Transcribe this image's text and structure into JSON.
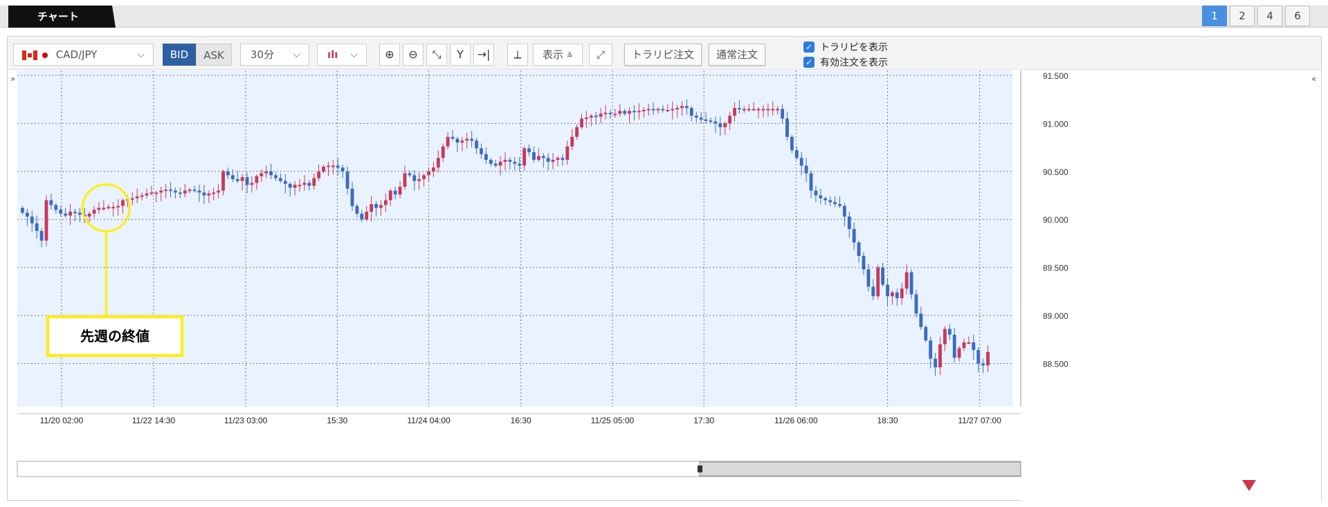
{
  "header": {
    "title": "チャート",
    "layouts": [
      "1",
      "2",
      "4",
      "6"
    ],
    "active_layout": "1"
  },
  "toolbar": {
    "pair": "CAD/JPY",
    "bid_label": "BID",
    "ask_label": "ASK",
    "interval": "30分",
    "show_label": "表示",
    "trail_order_label": "トラリピ注文",
    "normal_order_label": "通常注文",
    "checkbox_trail": "トラリピを表示",
    "checkbox_active_orders": "有効注文を表示",
    "icons": [
      "candlestick-icon",
      "zoom-in-icon",
      "zoom-out-icon",
      "fit-icon",
      "y-lock-icon",
      "jump-latest-icon",
      "add-indicator-icon",
      "expand-icon"
    ]
  },
  "annotation": {
    "label": "先週の終値",
    "color": "#ffee00"
  },
  "chart_data": {
    "type": "candlestick",
    "symbol": "CAD/JPY",
    "ylim": [
      88.05,
      91.55
    ],
    "y_ticks": [
      "91.500",
      "91.000",
      "90.500",
      "90.000",
      "89.500",
      "89.000",
      "88.500"
    ],
    "x_ticks": [
      "11/20 02:00",
      "11/22 14:30",
      "11/23 03:00",
      "15:30",
      "11/24 04:00",
      "16:30",
      "11/25 05:00",
      "17:30",
      "11/26 06:00",
      "18:30",
      "11/27 07:00"
    ],
    "up_color": "#c8385a",
    "down_color": "#3a6bbf",
    "background": "#e9f2ff",
    "grid": true,
    "close_path": [
      90.07,
      90.03,
      89.96,
      89.88,
      89.78,
      90.2,
      90.15,
      90.1,
      90.06,
      90.04,
      90.08,
      90.07,
      90.05,
      90.03,
      90.06,
      90.1,
      90.12,
      90.12,
      90.13,
      90.13,
      90.14,
      90.2,
      90.21,
      90.22,
      90.24,
      90.25,
      90.27,
      90.28,
      90.28,
      90.3,
      90.31,
      90.3,
      90.28,
      90.27,
      90.3,
      90.31,
      90.3,
      90.28,
      90.25,
      90.27,
      90.28,
      90.3,
      90.5,
      90.46,
      90.42,
      90.4,
      90.44,
      90.36,
      90.38,
      90.45,
      90.48,
      90.5,
      90.46,
      90.43,
      90.4,
      90.37,
      90.33,
      90.36,
      90.36,
      90.38,
      90.35,
      90.43,
      90.5,
      90.55,
      90.56,
      90.56,
      90.54,
      90.5,
      90.32,
      90.14,
      90.06,
      90.0,
      90.08,
      90.16,
      90.12,
      90.15,
      90.2,
      90.3,
      90.26,
      90.34,
      90.48,
      90.46,
      90.4,
      90.42,
      90.46,
      90.5,
      90.54,
      90.64,
      90.76,
      90.86,
      90.84,
      90.8,
      90.82,
      90.84,
      90.82,
      90.74,
      90.68,
      90.62,
      90.58,
      90.56,
      90.6,
      90.62,
      90.6,
      90.58,
      90.56,
      90.74,
      90.7,
      90.62,
      90.66,
      90.64,
      90.6,
      90.62,
      90.64,
      90.62,
      90.76,
      90.86,
      90.96,
      91.05,
      91.06,
      91.08,
      91.07,
      91.1,
      91.11,
      91.1,
      91.1,
      91.13,
      91.1,
      91.13,
      91.12,
      91.13,
      91.14,
      91.15,
      91.14,
      91.15,
      91.14,
      91.14,
      91.15,
      91.16,
      91.18,
      91.16,
      91.08,
      91.06,
      91.04,
      91.03,
      91.02,
      91.0,
      90.96,
      91.0,
      91.08,
      91.16,
      91.15,
      91.15,
      91.15,
      91.15,
      91.15,
      91.15,
      91.15,
      91.15,
      91.15,
      91.05,
      90.86,
      90.72,
      90.64,
      90.56,
      90.48,
      90.3,
      90.25,
      90.22,
      90.2,
      90.18,
      90.16,
      90.14,
      90.03,
      89.9,
      89.76,
      89.62,
      89.48,
      89.3,
      89.2,
      89.5,
      89.32,
      89.2,
      89.24,
      89.18,
      89.28,
      89.45,
      89.22,
      89.02,
      88.88,
      88.74,
      88.55,
      88.46,
      88.7,
      88.86,
      88.8,
      88.56,
      88.66,
      88.72,
      88.72,
      88.64,
      88.5,
      88.48,
      88.62
    ]
  }
}
